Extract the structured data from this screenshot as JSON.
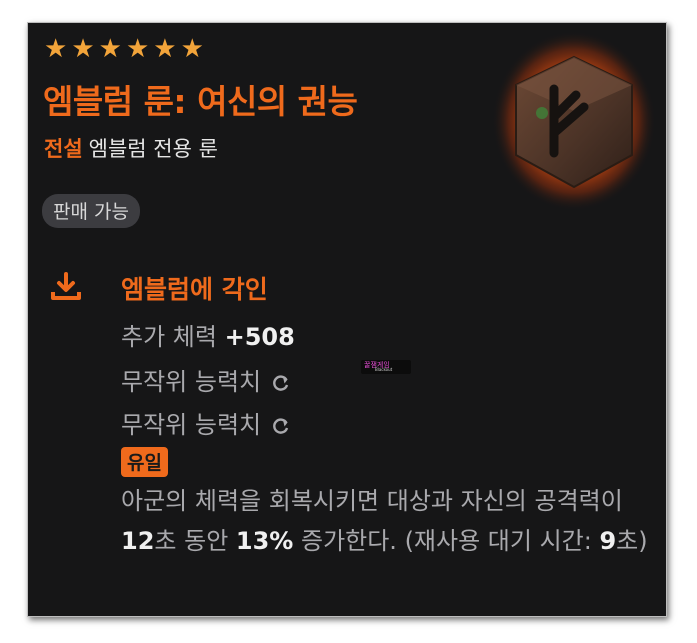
{
  "item": {
    "star_count": 6,
    "title": "엠블럼 룬: 여신의 권능",
    "grade": "전설",
    "type": "엠블럼 전용 룬",
    "sale_status": "판매 가능"
  },
  "engrave": {
    "icon": "download-icon",
    "title": "엠블럼에 각인",
    "stat_label": "추가 체력",
    "stat_value": "+508",
    "random_stat_1": "무작위 능력치",
    "random_stat_2": "무작위 능력치",
    "reroll_icon": "refresh-icon",
    "unique_label": "유일",
    "desc": {
      "part1": "아군의 체력을 회복시키면 대상과 자신의 공격력이 ",
      "duration": "12",
      "part2": "초 동안 ",
      "percent": "13%",
      "part3": " 증가한다. (재사용 대기 시간: ",
      "cooldown": "9",
      "part4": "초)"
    }
  },
  "watermark": {
    "text": "꿀잼게임",
    "sub": "Blackout"
  },
  "colors": {
    "accent": "#ef6a1c",
    "star": "#f2a43a",
    "background": "#161617",
    "muted_text": "#a9a9ad",
    "badge_bg": "#3c3c40"
  }
}
